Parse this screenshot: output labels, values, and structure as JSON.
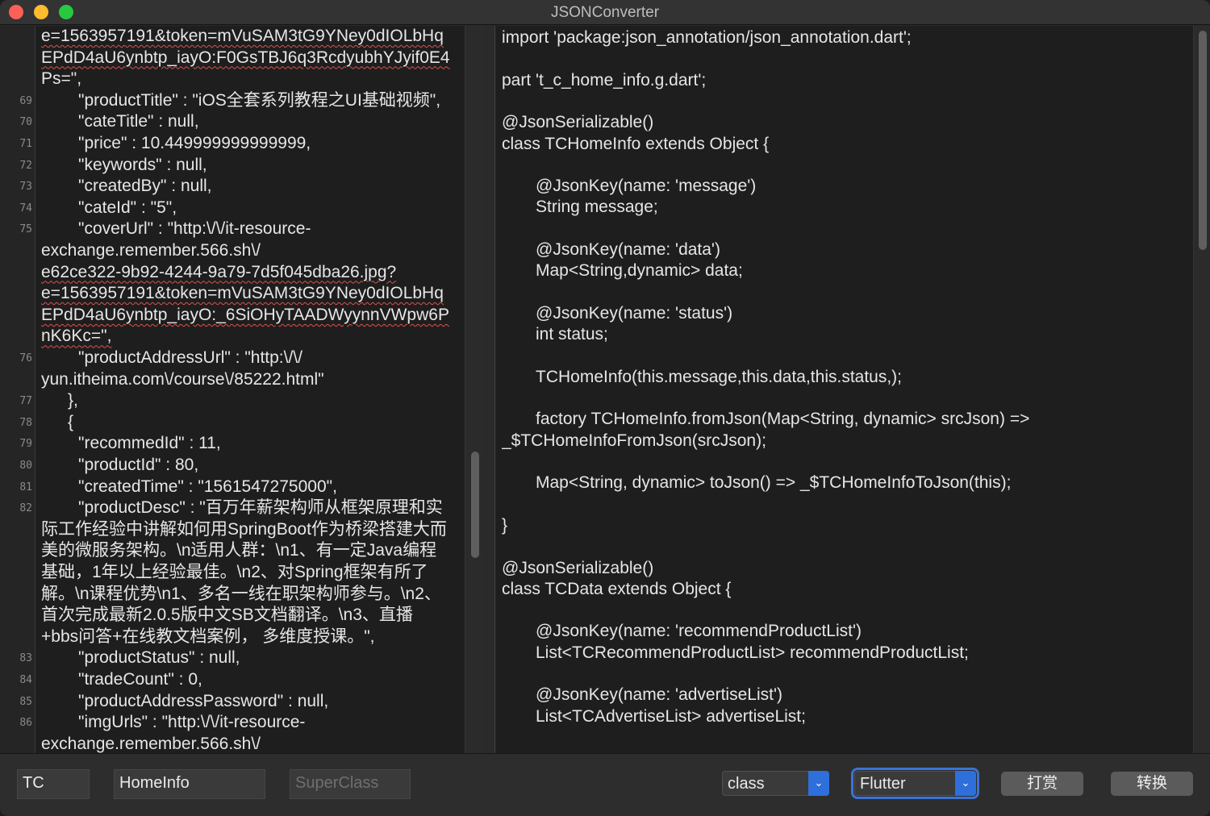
{
  "window": {
    "title": "JSONConverter"
  },
  "input_editor": {
    "lines": [
      {
        "num": "",
        "text": "e=1563957191&token=mVuSAM3tG9YNey0dIOLbHq",
        "indent": false,
        "squiggle": true
      },
      {
        "num": "",
        "text": "EPdD4aU6ynbtp_iayO:F0GsTBJ6q3RcdyubhYJyif0E4",
        "indent": false,
        "squiggle": true
      },
      {
        "num": "",
        "text": "Ps=\",",
        "indent": false,
        "squiggle": false
      },
      {
        "num": "69",
        "text": "\"productTitle\" : \"iOS全套系列教程之UI基础视频\",",
        "indent": true,
        "squiggle": false
      },
      {
        "num": "70",
        "text": "\"cateTitle\" : null,",
        "indent": true,
        "squiggle": false
      },
      {
        "num": "71",
        "text": "\"price\" : 10.449999999999999,",
        "indent": true,
        "squiggle": false
      },
      {
        "num": "72",
        "text": "\"keywords\" : null,",
        "indent": true,
        "squiggle": false
      },
      {
        "num": "73",
        "text": "\"createdBy\" : null,",
        "indent": true,
        "squiggle": false
      },
      {
        "num": "74",
        "text": "\"cateId\" : \"5\",",
        "indent": true,
        "squiggle": false
      },
      {
        "num": "75",
        "text": "\"coverUrl\" : \"http:\\/\\/it-resource-",
        "indent": true,
        "squiggle": false
      },
      {
        "num": "",
        "text": "exchange.remember.566.sh\\/",
        "indent": false,
        "squiggle": false
      },
      {
        "num": "",
        "text": "e62ce322-9b92-4244-9a79-7d5f045dba26.jpg?",
        "indent": false,
        "squiggle": true
      },
      {
        "num": "",
        "text": "e=1563957191&token=mVuSAM3tG9YNey0dIOLbHq",
        "indent": false,
        "squiggle": true
      },
      {
        "num": "",
        "text": "EPdD4aU6ynbtp_iayO:_6SiOHyTAADWyynnVWpw6P",
        "indent": false,
        "squiggle": true
      },
      {
        "num": "",
        "text": "nK6Kc=\",",
        "indent": false,
        "squiggle": true
      },
      {
        "num": "76",
        "text": "\"productAddressUrl\" : \"http:\\/\\/",
        "indent": true,
        "squiggle": false
      },
      {
        "num": "",
        "text": "yun.itheima.com\\/course\\/85222.html\"",
        "indent": false,
        "squiggle": false
      },
      {
        "num": "77",
        "text": "},",
        "indent": "half",
        "squiggle": false
      },
      {
        "num": "78",
        "text": "{",
        "indent": "half",
        "squiggle": false
      },
      {
        "num": "79",
        "text": "\"recommedId\" : 11,",
        "indent": true,
        "squiggle": false
      },
      {
        "num": "80",
        "text": "\"productId\" : 80,",
        "indent": true,
        "squiggle": false
      },
      {
        "num": "81",
        "text": "\"createdTime\" : \"1561547275000\",",
        "indent": true,
        "squiggle": false
      },
      {
        "num": "82",
        "text": "\"productDesc\" : \"百万年薪架构师从框架原理和实",
        "indent": true,
        "squiggle": false
      },
      {
        "num": "",
        "text": "际工作经验中讲解如何用SpringBoot作为桥梁搭建大而",
        "indent": false,
        "squiggle": false
      },
      {
        "num": "",
        "text": "美的微服务架构。\\n适用人群：\\n1、有一定Java编程",
        "indent": false,
        "squiggle": false
      },
      {
        "num": "",
        "text": "基础，1年以上经验最佳。\\n2、对Spring框架有所了",
        "indent": false,
        "squiggle": false
      },
      {
        "num": "",
        "text": "解。\\n课程优势\\n1、多名一线在职架构师参与。\\n2、",
        "indent": false,
        "squiggle": false
      },
      {
        "num": "",
        "text": "首次完成最新2.0.5版中文SB文档翻译。\\n3、直播",
        "indent": false,
        "squiggle": false
      },
      {
        "num": "",
        "text": "+bbs问答+在线教文档案例， 多维度授课。\",",
        "indent": false,
        "squiggle": false
      },
      {
        "num": "83",
        "text": "\"productStatus\" : null,",
        "indent": true,
        "squiggle": false
      },
      {
        "num": "84",
        "text": "\"tradeCount\" : 0,",
        "indent": true,
        "squiggle": false
      },
      {
        "num": "85",
        "text": "\"productAddressPassword\" : null,",
        "indent": true,
        "squiggle": false
      },
      {
        "num": "86",
        "text": "\"imgUrls\" : \"http:\\/\\/it-resource-",
        "indent": true,
        "squiggle": false
      },
      {
        "num": "",
        "text": "exchange.remember.566.sh\\/",
        "indent": false,
        "squiggle": false
      }
    ]
  },
  "output_editor": {
    "lines": [
      {
        "text": "import 'package:json_annotation/json_annotation.dart';",
        "indent": false
      },
      {
        "text": "",
        "indent": false
      },
      {
        "text": "part 't_c_home_info.g.dart';",
        "indent": false
      },
      {
        "text": "",
        "indent": false
      },
      {
        "text": "@JsonSerializable()",
        "indent": false
      },
      {
        "text": "class TCHomeInfo extends Object {",
        "indent": false
      },
      {
        "text": "",
        "indent": false
      },
      {
        "text": "@JsonKey(name: 'message')",
        "indent": true
      },
      {
        "text": "String message;",
        "indent": true
      },
      {
        "text": "",
        "indent": false
      },
      {
        "text": "@JsonKey(name: 'data')",
        "indent": true
      },
      {
        "text": "Map<String,dynamic> data;",
        "indent": true
      },
      {
        "text": "",
        "indent": false
      },
      {
        "text": "@JsonKey(name: 'status')",
        "indent": true
      },
      {
        "text": "int status;",
        "indent": true
      },
      {
        "text": "",
        "indent": false
      },
      {
        "text": "TCHomeInfo(this.message,this.data,this.status,);",
        "indent": true
      },
      {
        "text": "",
        "indent": false
      },
      {
        "text": "factory TCHomeInfo.fromJson(Map<String, dynamic> srcJson) =>",
        "indent": true
      },
      {
        "text": "_$TCHomeInfoFromJson(srcJson);",
        "indent": false
      },
      {
        "text": "",
        "indent": false
      },
      {
        "text": "Map<String, dynamic> toJson() => _$TCHomeInfoToJson(this);",
        "indent": true
      },
      {
        "text": "",
        "indent": false
      },
      {
        "text": "}",
        "indent": false
      },
      {
        "text": "",
        "indent": false
      },
      {
        "text": "@JsonSerializable()",
        "indent": false
      },
      {
        "text": "class TCData extends Object {",
        "indent": false
      },
      {
        "text": "",
        "indent": false
      },
      {
        "text": "@JsonKey(name: 'recommendProductList')",
        "indent": true
      },
      {
        "text": "List<TCRecommendProductList> recommendProductList;",
        "indent": true
      },
      {
        "text": "",
        "indent": false
      },
      {
        "text": "@JsonKey(name: 'advertiseList')",
        "indent": true
      },
      {
        "text": "List<TCAdvertiseList> advertiseList;",
        "indent": true
      }
    ]
  },
  "toolbar": {
    "prefix_value": "TC",
    "class_name_value": "HomeInfo",
    "superclass_placeholder": "SuperClass",
    "type_select": "class",
    "language_select": "Flutter",
    "tip_button": "打赏",
    "convert_button": "转换"
  },
  "colors": {
    "traffic_close": "#fe5f57",
    "traffic_minimize": "#febc2e",
    "traffic_zoom": "#28c840",
    "accent": "#2f6fdc",
    "squiggle": "#d9534f"
  },
  "icons": {
    "select_arrow": "chevron-down-icon"
  }
}
